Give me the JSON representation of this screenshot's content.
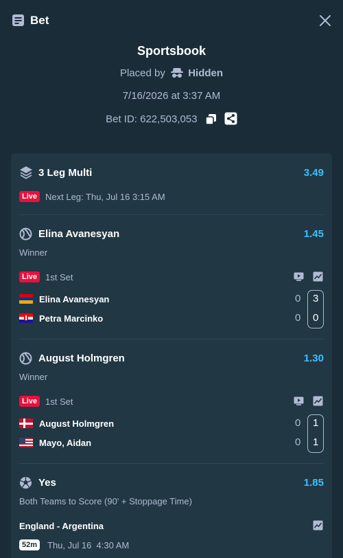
{
  "header": {
    "title": "Bet"
  },
  "summary": {
    "title": "Sportsbook",
    "placed_by_label": "Placed by",
    "placed_by_user": "Hidden",
    "datetime": "7/16/2026 at 3:37 AM",
    "bet_id": "Bet ID: 622,503,053"
  },
  "multi": {
    "title": "3 Leg Multi",
    "odds": "3.49",
    "live": "Live",
    "next_leg": "Next Leg: Thu, Jul 16 3:15 AM"
  },
  "legs": [
    {
      "selection": "Elina Avanesyan",
      "odds": "1.45",
      "market": "Winner",
      "live": "Live",
      "period": "1st Set",
      "home": {
        "name": "Elina Avanesyan",
        "games": "0",
        "set": "3"
      },
      "away": {
        "name": "Petra Marcinko",
        "games": "0",
        "set": "0"
      }
    },
    {
      "selection": "August Holmgren",
      "odds": "1.30",
      "market": "Winner",
      "live": "Live",
      "period": "1st Set",
      "home": {
        "name": "August Holmgren",
        "games": "0",
        "set": "1"
      },
      "away": {
        "name": "Mayo, Aidan",
        "games": "0",
        "set": "1"
      }
    },
    {
      "selection": "Yes",
      "odds": "1.85",
      "market": "Both Teams to Score (90' + Stoppage Time)",
      "match": "England - Argentina",
      "countdown": "52m",
      "kickoff": "Thu, Jul 16  4:30 AM"
    }
  ],
  "colors": {
    "background": "#1a2c38",
    "card": "#213743",
    "odds": "#3bc0ff",
    "live": "#e9113c",
    "muted": "#b1bad3"
  }
}
